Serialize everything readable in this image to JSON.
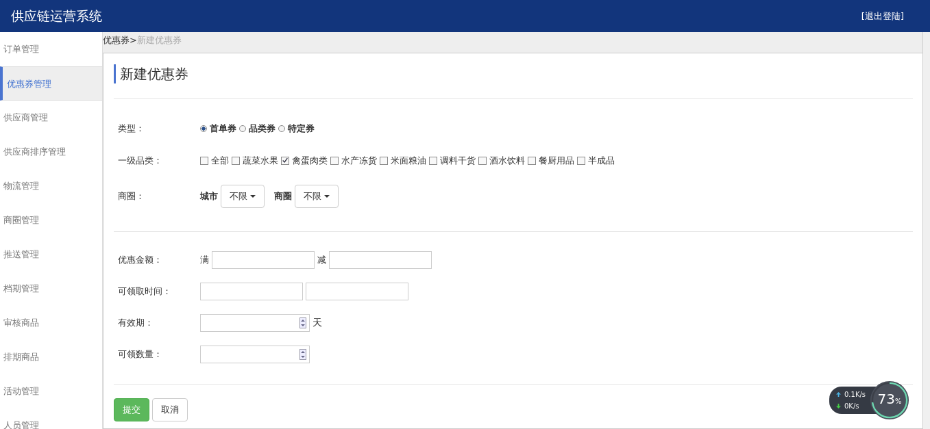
{
  "header": {
    "title": "供应链运营系统",
    "logout": "[退出登陆]"
  },
  "sidebar": {
    "items": [
      {
        "label": "订单管理",
        "selected": false
      },
      {
        "label": "优惠券管理",
        "selected": true
      },
      {
        "label": "供应商管理",
        "selected": false
      },
      {
        "label": "供应商排序管理",
        "selected": false
      },
      {
        "label": "物流管理",
        "selected": false
      },
      {
        "label": "商圈管理",
        "selected": false
      },
      {
        "label": "推送管理",
        "selected": false
      },
      {
        "label": "档期管理",
        "selected": false
      },
      {
        "label": "审核商品",
        "selected": false
      },
      {
        "label": "排期商品",
        "selected": false
      },
      {
        "label": "活动管理",
        "selected": false
      },
      {
        "label": "人员管理",
        "selected": false
      }
    ]
  },
  "breadcrumb": {
    "parent": "优惠券",
    "separator": ">",
    "current": "新建优惠券"
  },
  "form": {
    "title": "新建优惠券",
    "type": {
      "label": "类型：",
      "options": [
        {
          "label": "首单券",
          "selected": true
        },
        {
          "label": "品类券",
          "selected": false
        },
        {
          "label": "特定券",
          "selected": false
        }
      ]
    },
    "category": {
      "label": "一级品类：",
      "options": [
        {
          "label": "全部",
          "checked": false
        },
        {
          "label": "蔬菜水果",
          "checked": false
        },
        {
          "label": "禽蛋肉类",
          "checked": true
        },
        {
          "label": "水产冻货",
          "checked": false
        },
        {
          "label": "米面粮油",
          "checked": false
        },
        {
          "label": "调料干货",
          "checked": false
        },
        {
          "label": "酒水饮料",
          "checked": false
        },
        {
          "label": "餐厨用品",
          "checked": false
        },
        {
          "label": "半成品",
          "checked": false
        }
      ]
    },
    "area": {
      "label": "商圈：",
      "selects": [
        {
          "label": "城市",
          "value": "不限"
        },
        {
          "label": "商圈",
          "value": "不限"
        }
      ]
    },
    "amount": {
      "label": "优惠金额：",
      "full": "满",
      "minus": "减"
    },
    "claim_time": {
      "label": "可领取时间："
    },
    "validity": {
      "label": "有效期：",
      "unit": "天"
    },
    "quantity": {
      "label": "可领数量："
    },
    "buttons": [
      {
        "label": "提交",
        "kind": "primary"
      },
      {
        "label": "取消",
        "kind": "default"
      }
    ]
  },
  "net_widget": {
    "up": "0.1K/s",
    "down": "0K/s",
    "percent": "73",
    "percent_sign": "%"
  }
}
